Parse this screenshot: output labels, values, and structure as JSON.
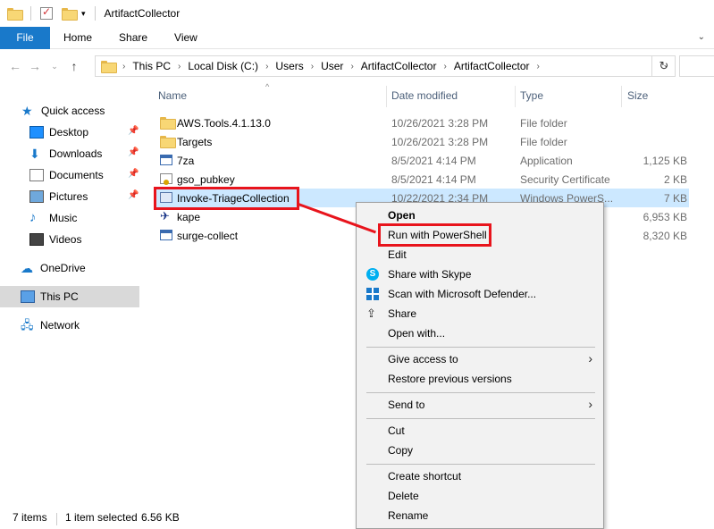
{
  "window": {
    "title": "ArtifactCollector"
  },
  "ribbon": {
    "tabs": [
      "File",
      "Home",
      "Share",
      "View"
    ]
  },
  "address": {
    "crumbs": [
      "This PC",
      "Local Disk (C:)",
      "Users",
      "User",
      "ArtifactCollector",
      "ArtifactCollector"
    ]
  },
  "nav": {
    "items": [
      {
        "label": "Quick access",
        "icon": "star-icon"
      },
      {
        "label": "Desktop",
        "icon": "desktop-icon",
        "pinned": true
      },
      {
        "label": "Downloads",
        "icon": "downloads-icon",
        "pinned": true
      },
      {
        "label": "Documents",
        "icon": "documents-icon",
        "pinned": true
      },
      {
        "label": "Pictures",
        "icon": "pictures-icon",
        "pinned": true
      },
      {
        "label": "Music",
        "icon": "music-icon"
      },
      {
        "label": "Videos",
        "icon": "videos-icon"
      },
      {
        "label": "OneDrive",
        "icon": "onedrive-icon"
      },
      {
        "label": "This PC",
        "icon": "this-pc-icon",
        "selected": true
      },
      {
        "label": "Network",
        "icon": "network-icon"
      }
    ]
  },
  "columns": {
    "name": "Name",
    "date": "Date modified",
    "type": "Type",
    "size": "Size"
  },
  "files": [
    {
      "name": "AWS.Tools.4.1.13.0",
      "date": "10/26/2021 3:28 PM",
      "type": "File folder",
      "size": "",
      "icon": "folder-icon"
    },
    {
      "name": "Targets",
      "date": "10/26/2021 3:28 PM",
      "type": "File folder",
      "size": "",
      "icon": "folder-icon"
    },
    {
      "name": "7za",
      "date": "8/5/2021 4:14 PM",
      "type": "Application",
      "size": "1,125 KB",
      "icon": "application-icon"
    },
    {
      "name": "gso_pubkey",
      "date": "8/5/2021 4:14 PM",
      "type": "Security Certificate",
      "size": "2 KB",
      "icon": "certificate-icon"
    },
    {
      "name": "Invoke-TriageCollection",
      "date": "10/22/2021 2:34 PM",
      "type": "Windows PowerS...",
      "size": "7 KB",
      "icon": "powershell-script-icon",
      "selected": true
    },
    {
      "name": "kape",
      "date": "",
      "type": "",
      "size": "6,953 KB",
      "icon": "kape-icon"
    },
    {
      "name": "surge-collect",
      "date": "",
      "type": "",
      "size": "8,320 KB",
      "icon": "application-icon"
    }
  ],
  "context_menu": {
    "open": "Open",
    "run_with_powershell": "Run with PowerShell",
    "edit": "Edit",
    "share_with_skype": "Share with Skype",
    "scan_with_defender": "Scan with Microsoft Defender...",
    "share": "Share",
    "open_with": "Open with...",
    "give_access_to": "Give access to",
    "restore_previous_versions": "Restore previous versions",
    "send_to": "Send to",
    "cut": "Cut",
    "copy": "Copy",
    "create_shortcut": "Create shortcut",
    "delete": "Delete",
    "rename": "Rename"
  },
  "status": {
    "item_count": "7 items",
    "selection": "1 item selected",
    "selection_size": "6.56 KB"
  },
  "colors": {
    "accent": "#1979ca",
    "annotation_red": "#e8141c",
    "selection": "#cce8ff"
  }
}
